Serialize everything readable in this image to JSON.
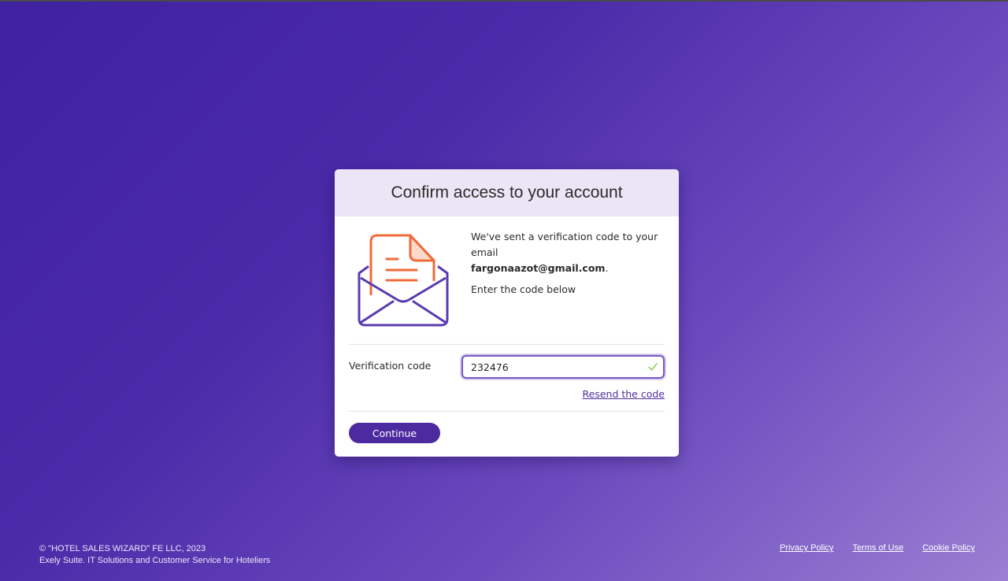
{
  "card": {
    "title": "Confirm access to your account",
    "message_line1": "We've sent a verification code to your email",
    "email": "fargonaazot@gmail.com",
    "email_suffix": ".",
    "instruction": "Enter the code below",
    "illustration_icon": "envelope-with-letter-icon"
  },
  "form": {
    "code_label": "Verification code",
    "code_value": "232476",
    "valid_icon": "check-icon",
    "resend_label": "Resend the code",
    "continue_label": "Continue"
  },
  "footer": {
    "copyright": "© \"HOTEL SALES WIZARD\" FE LLC, 2023",
    "tagline": "Exely Suite. IT Solutions and Customer Service for Hoteliers",
    "links": [
      "Privacy Policy",
      "Terms of Use",
      "Cookie Policy"
    ]
  },
  "colors": {
    "accent": "#4c2aa0",
    "header_bg": "#ebe5f5",
    "illustration_orange": "#f06a3a",
    "illustration_purple": "#5a3bb0",
    "valid_green": "#8bc34a"
  }
}
